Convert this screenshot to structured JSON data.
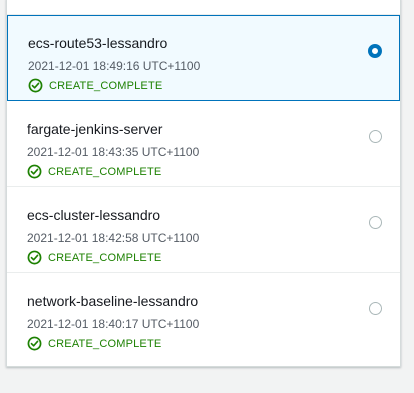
{
  "stacks": [
    {
      "name": "ecs-route53-lessandro",
      "time": "2021-12-01 18:49:16 UTC+1100",
      "status": "CREATE_COMPLETE",
      "selected": true
    },
    {
      "name": "fargate-jenkins-server",
      "time": "2021-12-01 18:43:35 UTC+1100",
      "status": "CREATE_COMPLETE",
      "selected": false
    },
    {
      "name": "ecs-cluster-lessandro",
      "time": "2021-12-01 18:42:58 UTC+1100",
      "status": "CREATE_COMPLETE",
      "selected": false
    },
    {
      "name": "network-baseline-lessandro",
      "time": "2021-12-01 18:40:17 UTC+1100",
      "status": "CREATE_COMPLETE",
      "selected": false
    }
  ],
  "colors": {
    "status_success": "#1d8102",
    "selected_border": "#0073bb",
    "selected_background": "#f1faff"
  },
  "icons": {
    "status": "check-circle-icon",
    "selection": "radio-button"
  }
}
